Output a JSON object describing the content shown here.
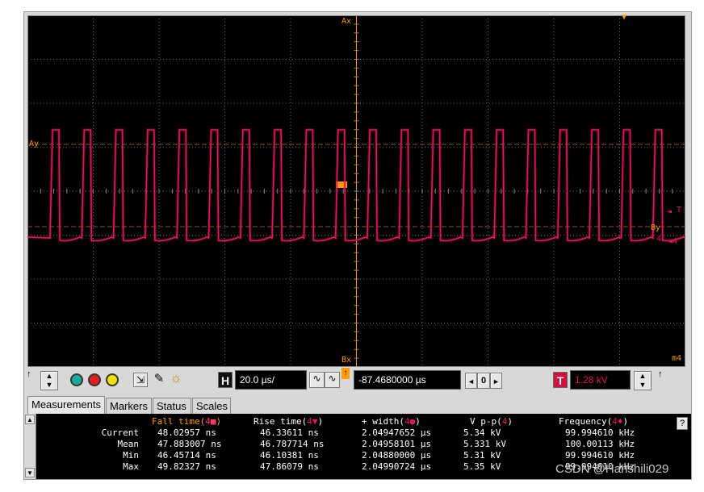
{
  "screen": {
    "labels": {
      "ax_top": "Ax",
      "ay_left": "Ay",
      "bx_bottom": "Bx",
      "by_right": "By",
      "ch4_right": "4",
      "t_right": "T",
      "m4": "m4"
    }
  },
  "toolbar": {
    "h_label": "H",
    "timebase": "20.0 µs/",
    "delay": "-87.4680000 µs",
    "zero": "0",
    "t_label": "T",
    "trigger_level": "1.28 kV"
  },
  "tabs": [
    {
      "label": "Measurements"
    },
    {
      "label": "Markers"
    },
    {
      "label": "Status"
    },
    {
      "label": "Scales"
    }
  ],
  "measurements": {
    "help": "?",
    "headers": [
      {
        "name": "Fall time(",
        "ch": "4",
        "sym": "■",
        "end": ")"
      },
      {
        "name": "Rise time(",
        "ch": "4",
        "sym": "▼",
        "end": ")"
      },
      {
        "name": "+ width(",
        "ch": "4",
        "sym": "●",
        "end": ")"
      },
      {
        "name": "V p-p(",
        "ch": "4",
        "sym": "",
        "end": ")"
      },
      {
        "name": "Frequency(",
        "ch": "4",
        "sym": "♦",
        "end": ")"
      }
    ],
    "rows": [
      {
        "label": "Current",
        "values": [
          "48.02957 ns",
          "46.33611 ns",
          "2.04947652 µs",
          "5.34 kV",
          "99.994610 kHz"
        ]
      },
      {
        "label": "Mean",
        "values": [
          "47.883007 ns",
          "46.787714 ns",
          "2.04958101 µs",
          "5.331 kV",
          "100.00113 kHz"
        ]
      },
      {
        "label": "Min",
        "values": [
          "46.45714 ns",
          "46.10381 ns",
          "2.04880000 µs",
          "5.31 kV",
          "99.994610 kHz"
        ]
      },
      {
        "label": "Max",
        "values": [
          "49.82327 ns",
          "47.86079 ns",
          "2.04990724 µs",
          "5.35 kV",
          "99.994610 kHz"
        ]
      }
    ]
  },
  "watermark": "CSDN @Hanshili029",
  "colors": {
    "trace": "#e0185a",
    "marker": "#ff9a00",
    "grid": "#6a6a6a"
  }
}
